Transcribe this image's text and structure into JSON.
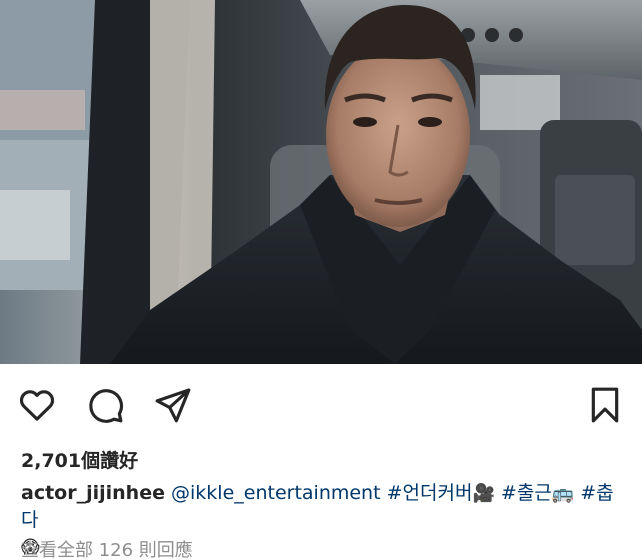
{
  "post": {
    "photo": {
      "subject": "selfie-in-van"
    },
    "actions": {
      "like_icon": "heart-icon",
      "comment_icon": "comment-icon",
      "share_icon": "send-icon",
      "save_icon": "bookmark-icon"
    },
    "likes_text": "2,701個讚好",
    "caption": {
      "username": "actor_jijinhee",
      "mention": "@ikkle_entertainment",
      "tag1": "#언더커버",
      "emoji1": "🎥",
      "tag2": "#출근",
      "emoji2": "🚌",
      "tag3": "#춥다",
      "emoji3": "😱"
    },
    "comments_link": "查看全部 126 則回應"
  },
  "colors": {
    "text": "#262626",
    "link": "#00376b",
    "muted": "#8e8e8e"
  }
}
